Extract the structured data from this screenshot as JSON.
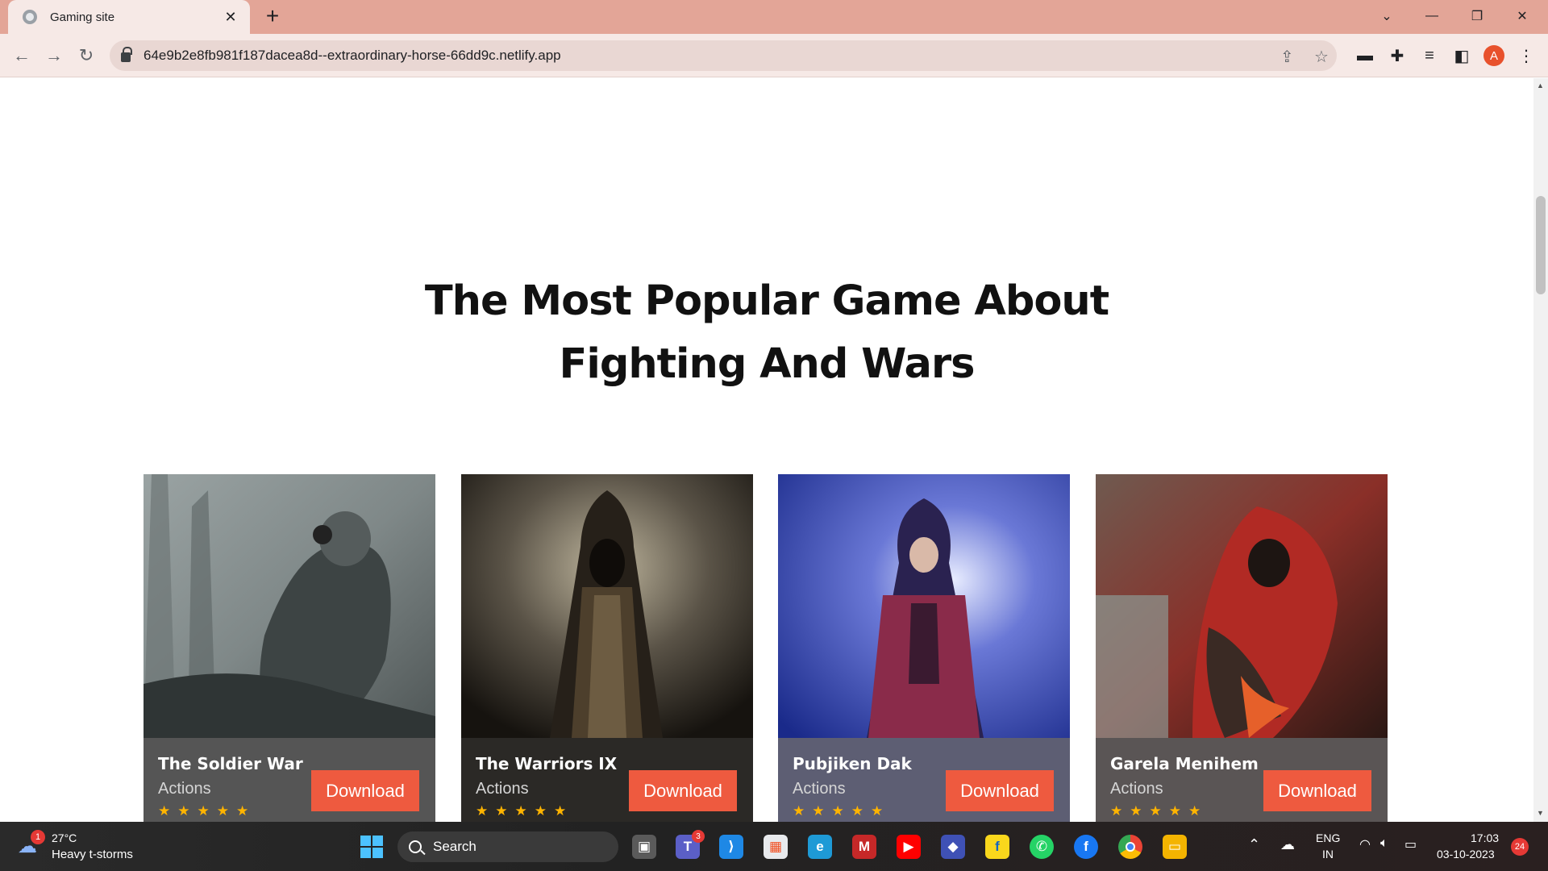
{
  "browser": {
    "tab_title": "Gaming site",
    "tab_close": "✕",
    "new_tab": "+",
    "url": "64e9b2e8fb981f187dacea8d--extraordinary-horse-66dd9c.netlify.app",
    "profile_initial": "A",
    "window_controls": {
      "dropdown": "⌄",
      "minimize": "—",
      "restore": "❐",
      "close": "✕"
    },
    "nav": {
      "back": "←",
      "forward": "→",
      "reload": "↻"
    },
    "toolbar_icons": [
      "share-icon",
      "star-icon",
      "cast-icon",
      "extensions-icon",
      "reading-list-icon",
      "side-panel-icon",
      "menu-icon"
    ]
  },
  "page": {
    "heading_line1": "The Most Popular Game About",
    "heading_line2": "Fighting And Wars",
    "cards": [
      {
        "title": "The Soldier War",
        "genre": "Actions",
        "button": "Download",
        "stars": "★★★★★",
        "rating": 5,
        "panel_color": "#555555"
      },
      {
        "title": "The Warriors IX",
        "genre": "Actions",
        "button": "Download",
        "stars": "★★★★★",
        "rating": 5,
        "panel_color": "#2b2926"
      },
      {
        "title": "Pubjiken Dak",
        "genre": "Actions",
        "button": "Download",
        "stars": "★★★★★",
        "rating": 5,
        "panel_color": "#5d5e73"
      },
      {
        "title": "Garela Menihem",
        "genre": "Actions",
        "button": "Download",
        "stars": "★★★★★",
        "rating": 5,
        "panel_color": "#5a5555"
      }
    ],
    "accent_color": "#ee5a3f"
  },
  "taskbar": {
    "weather_badge": "1",
    "temperature": "27°C",
    "weather": "Heavy t-storms",
    "search_label": "Search",
    "teams_badge": "3",
    "language": "ENG",
    "region": "IN",
    "time": "17:03",
    "date": "03-10-2023",
    "notifications": "24",
    "apps": [
      "task-view",
      "teams",
      "vscode",
      "store",
      "edge",
      "mcafee",
      "youtube",
      "copilot",
      "flipkart",
      "whatsapp",
      "facebook",
      "chrome",
      "file-explorer"
    ]
  }
}
